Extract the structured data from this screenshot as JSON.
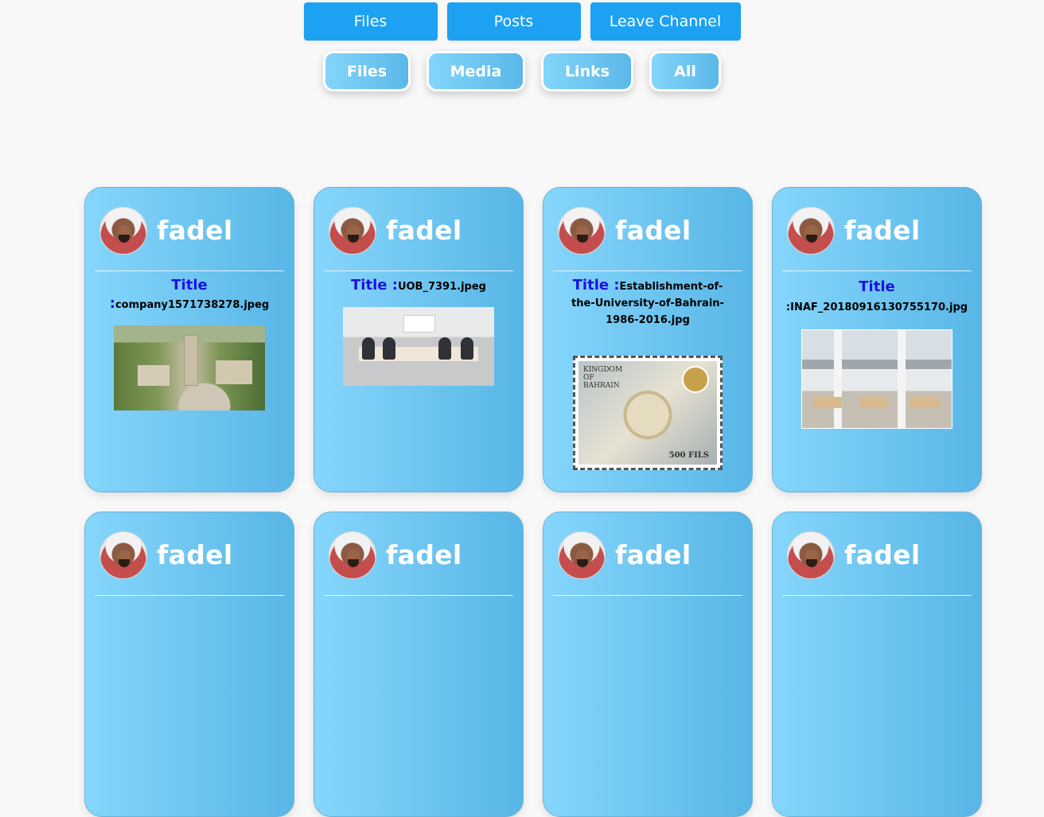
{
  "top_nav": {
    "files": "Files",
    "posts": "Posts",
    "leave": "Leave Channel"
  },
  "filters": {
    "files": "Files",
    "media": "Media",
    "links": "Links",
    "all": "All"
  },
  "cards": [
    {
      "user": "fadel",
      "title_label": "Title :",
      "title": "company1571738278.jpeg"
    },
    {
      "user": "fadel",
      "title_label": "Title :",
      "title": "UOB_7391.jpeg"
    },
    {
      "user": "fadel",
      "title_label": "Title :",
      "title": "Establishment-of-the-University-of-Bahrain-1986-2016.jpg",
      "stamp_text": "KINGDOM OF BAHRAIN",
      "stamp_value": "500 FILS"
    },
    {
      "user": "fadel",
      "title_label": "Title",
      "title": ":INAF_20180916130755170.jpg"
    },
    {
      "user": "fadel"
    },
    {
      "user": "fadel"
    },
    {
      "user": "fadel"
    },
    {
      "user": "fadel"
    }
  ]
}
